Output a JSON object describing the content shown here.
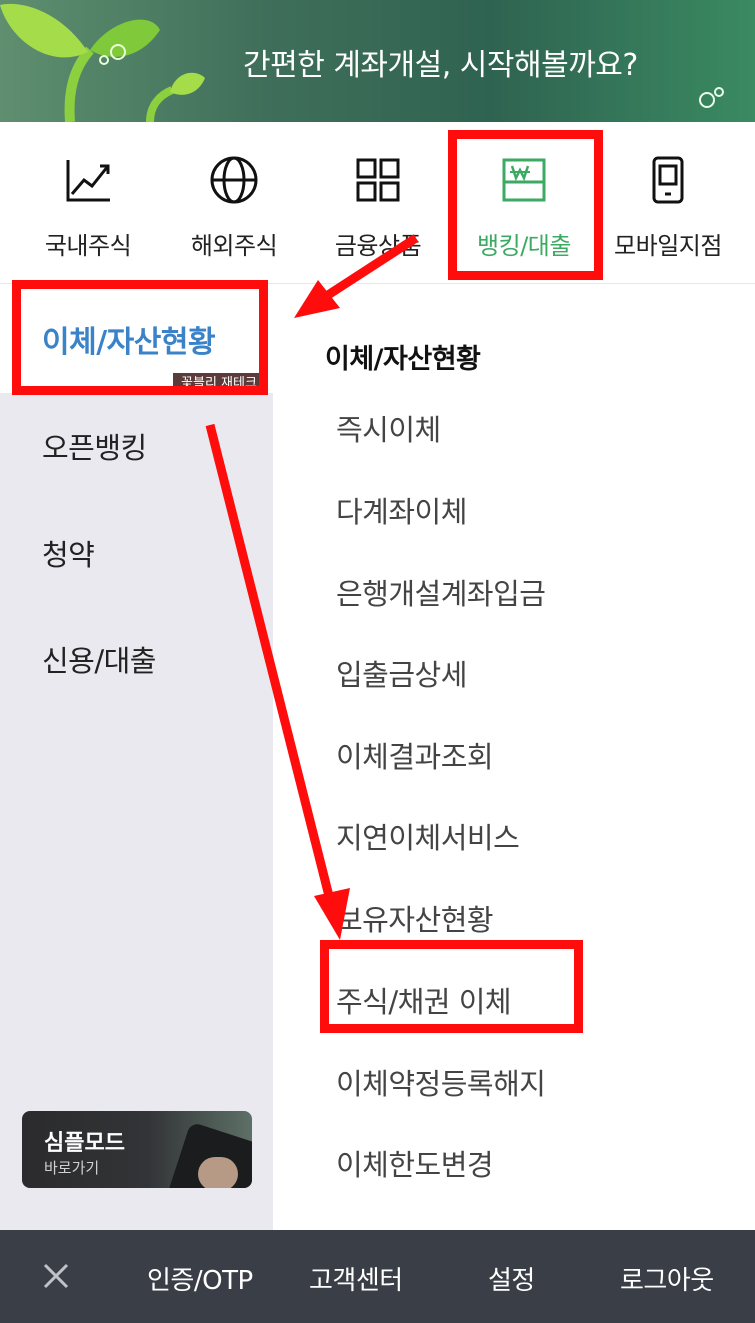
{
  "banner": {
    "text": "간편한 계좌개설, 시작해볼까요?"
  },
  "tabs": [
    {
      "label": "국내주식",
      "icon": "stock-chart-icon"
    },
    {
      "label": "해외주식",
      "icon": "globe-icon"
    },
    {
      "label": "금융상품",
      "icon": "grid-icon"
    },
    {
      "label": "뱅킹/대출",
      "icon": "won-bill-icon",
      "active": true
    },
    {
      "label": "모바일지점",
      "icon": "mobile-phone-icon"
    }
  ],
  "left_menu": {
    "selected": "이체/자산현황",
    "items": [
      "오픈뱅킹",
      "청약",
      "신용/대출"
    ],
    "watermark": "꽃블리 재테크",
    "simple_mode": {
      "title": "심플모드",
      "subtitle": "바로가기"
    }
  },
  "submenu": {
    "heading": "이체/자산현황",
    "items": [
      "즉시이체",
      "다계좌이체",
      "은행개설계좌입금",
      "입출금상세",
      "이체결과조회",
      "지연이체서비스",
      "보유자산현황",
      "주식/채권 이체",
      "이체약정등록해지",
      "이체한도변경"
    ]
  },
  "bottom_bar": {
    "items": [
      "인증/OTP",
      "고객센터",
      "설정",
      "로그아웃"
    ]
  },
  "colors": {
    "accent_green": "#3daa63",
    "accent_blue": "#3b83c8",
    "annotation_red": "#ff0d0d",
    "bottom_bar": "#3a3f47"
  }
}
